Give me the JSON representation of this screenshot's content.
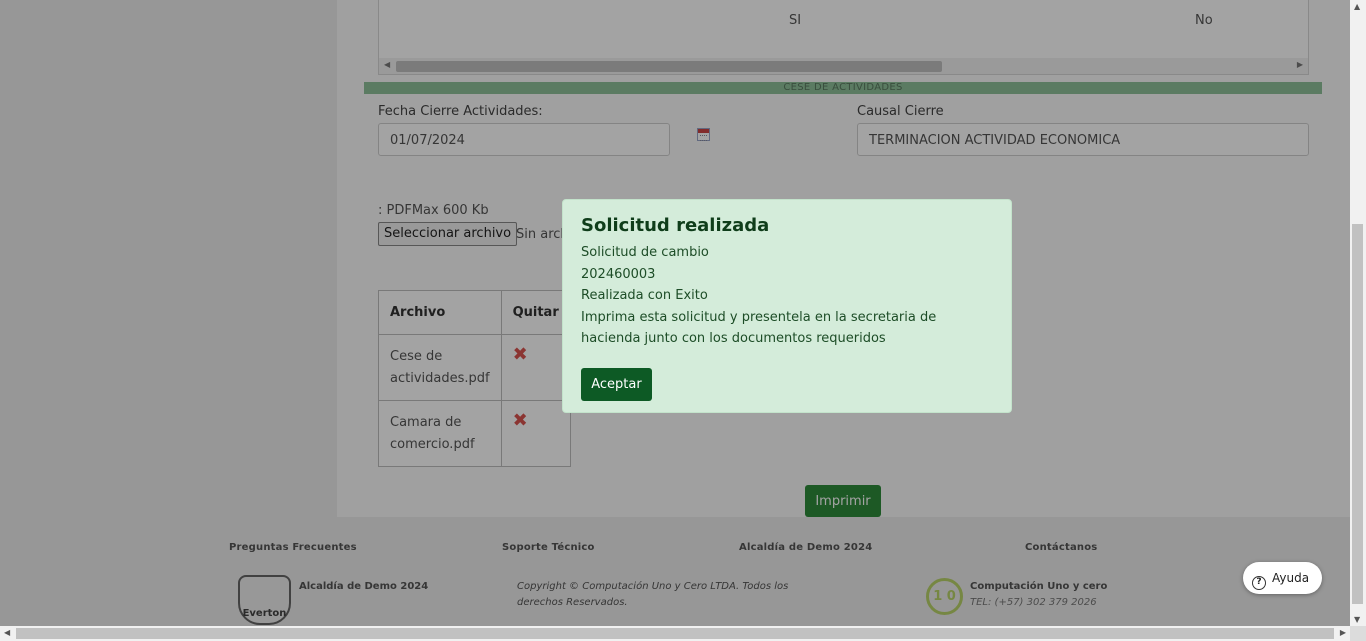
{
  "top_table": {
    "value_1": "SI",
    "value_2": "No"
  },
  "section_title": "CESE DE ACTIVIDADES",
  "form": {
    "fecha_label": "Fecha Cierre Actividades:",
    "fecha_value": "01/07/2024",
    "causal_label": "Causal Cierre",
    "causal_value": "TERMINACION ACTIVIDAD ECONOMICA",
    "pdf_note": ": PDFMax 600 Kb",
    "file_button": "Seleccionar archivo",
    "file_none": "Sin arch"
  },
  "files_table": {
    "headers": [
      "Archivo",
      "Quitar"
    ],
    "rows": [
      {
        "name": "Cese de actividades.pdf",
        "remove_icon": "delete-x-icon"
      },
      {
        "name": "Camara de comercio.pdf",
        "remove_icon": "delete-x-icon"
      }
    ]
  },
  "print_button": "Imprimir",
  "footer": {
    "headings": [
      "Preguntas Frecuentes",
      "Soporte Técnico",
      "Alcaldía de Demo 2024",
      "Contáctanos"
    ],
    "alcaldia_name": "Alcaldía de Demo 2024",
    "logo_text": "Everton",
    "copyright": "Copyright © Computación Uno y Cero LTDA. Todos los derechos Reservados.",
    "company_name": "Computación Uno y cero",
    "company_logo": "1 0",
    "tel": "TEL: (+57) 302 379 2026"
  },
  "help_button": "Ayuda",
  "modal": {
    "title": "Solicitud realizada",
    "lines": [
      "Solicitud de cambio",
      "202460003",
      "Realizada con Exito",
      "Imprima esta solicitud y presentela en la secretaria de hacienda junto con los documentos requeridos"
    ],
    "ok_button": "Aceptar"
  },
  "colors": {
    "accent": "#2e8b3a",
    "modal_bg": "#d4ecda",
    "modal_button": "#0d5a25",
    "section_bar": "#8fc09a"
  }
}
